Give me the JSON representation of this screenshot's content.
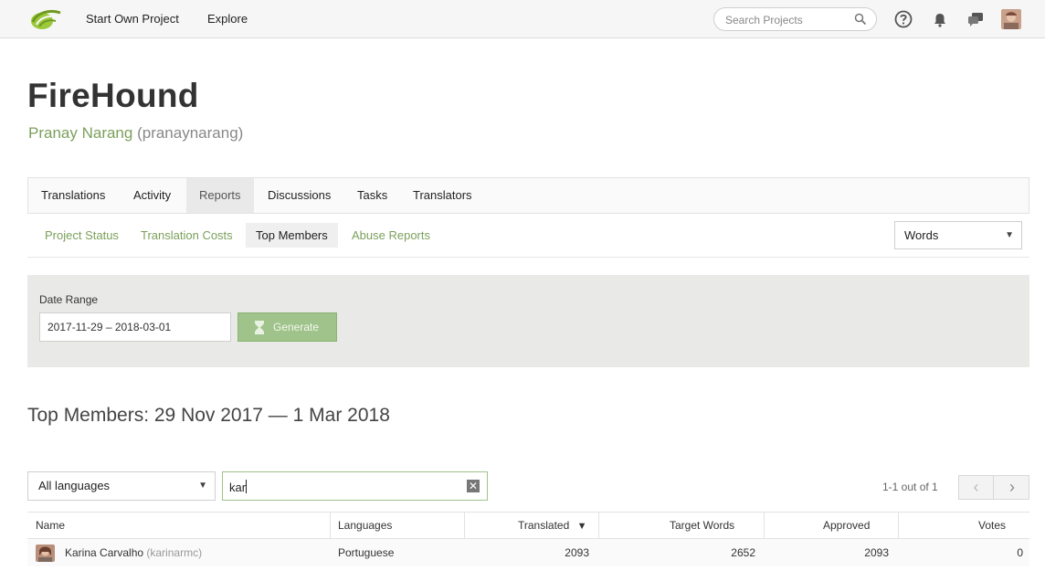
{
  "topnav": {
    "start_own_project": "Start Own Project",
    "explore": "Explore",
    "search_placeholder": "Search Projects",
    "icons": [
      "help-icon",
      "bell-icon",
      "chat-icon",
      "user-avatar"
    ]
  },
  "project": {
    "title": "FireHound",
    "owner_name": "Pranay Narang",
    "owner_handle": "(pranaynarang)"
  },
  "tabs": [
    {
      "label": "Translations",
      "active": false
    },
    {
      "label": "Activity",
      "active": false
    },
    {
      "label": "Reports",
      "active": true
    },
    {
      "label": "Discussions",
      "active": false
    },
    {
      "label": "Tasks",
      "active": false
    },
    {
      "label": "Translators",
      "active": false
    }
  ],
  "subtabs": [
    {
      "label": "Project Status",
      "active": false
    },
    {
      "label": "Translation Costs",
      "active": false
    },
    {
      "label": "Top Members",
      "active": true
    },
    {
      "label": "Abuse Reports",
      "active": false
    }
  ],
  "metric_select": {
    "value": "Words"
  },
  "filter": {
    "date_range_label": "Date Range",
    "date_range_value": "2017-11-29 – 2018-03-01",
    "generate_label": "Generate"
  },
  "section_title": "Top Members: 29 Nov 2017 — 1 Mar 2018",
  "table_controls": {
    "language_select": "All languages",
    "member_filter": "kar",
    "pager_text": "1-1 out of 1"
  },
  "table": {
    "columns": [
      "Name",
      "Languages",
      "Translated",
      "Target Words",
      "Approved",
      "Votes"
    ],
    "sorted_column": "Translated",
    "rows": [
      {
        "name": "Karina Carvalho",
        "username": "(karinarmc)",
        "language": "Portuguese",
        "translated": "2093",
        "target_words": "2652",
        "approved": "2093",
        "votes": "0"
      }
    ]
  },
  "colors": {
    "accent_green": "#7ba05b",
    "button_green": "#9fc38a",
    "panel_gray": "#e9e9e7"
  }
}
